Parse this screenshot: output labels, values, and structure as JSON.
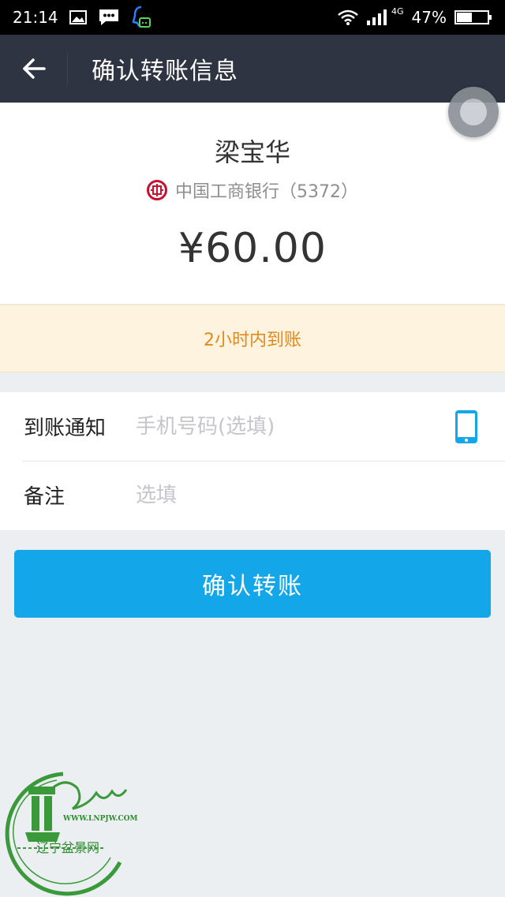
{
  "status_bar": {
    "time": "21:14",
    "network_type": "4G",
    "battery_percent": "47%",
    "battery_level": 0.47
  },
  "header": {
    "title": "确认转账信息",
    "back_icon": "arrow-left-icon"
  },
  "recipient": {
    "name": "梁宝华",
    "bank_name": "中国工商银行（5372）",
    "bank_logo_icon": "icbc-logo-icon",
    "amount": "¥60.00"
  },
  "arrival_notice": "2小时内到账",
  "form": {
    "notify_label": "到账通知",
    "notify_placeholder": "手机号码(选填)",
    "notify_value": "",
    "phone_icon": "phone-icon",
    "remark_label": "备注",
    "remark_placeholder": "选填",
    "remark_value": ""
  },
  "confirm_button": "确认转账",
  "watermark": {
    "url": "WWW.LNPJW.COM",
    "name": "辽宁盆景网"
  },
  "colors": {
    "header_bg": "#2f3442",
    "accent": "#13a6e8",
    "notice_bg": "#fdf3df",
    "notice_text": "#e08a1e",
    "page_bg": "#ebeff2"
  }
}
